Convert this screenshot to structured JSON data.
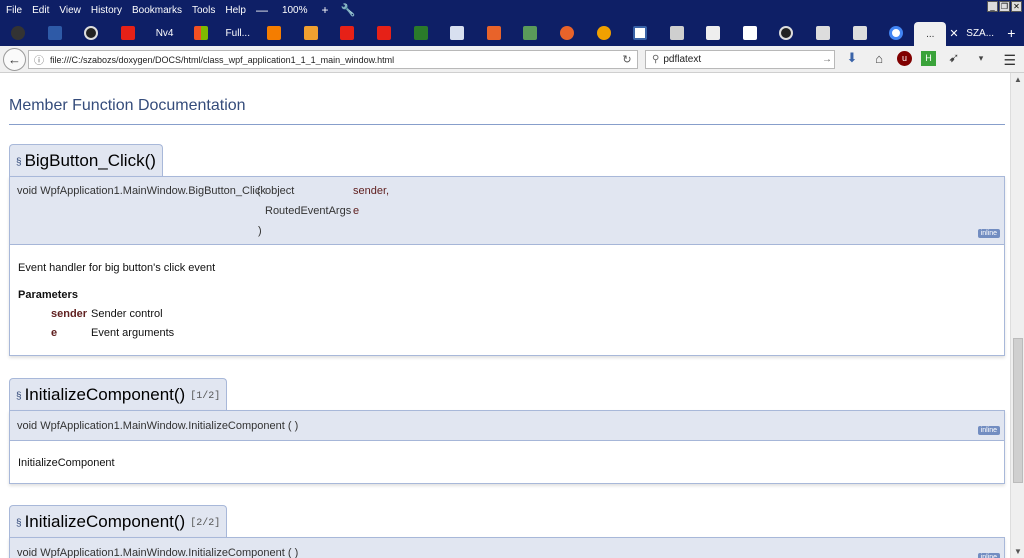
{
  "menubar": {
    "items": [
      "File",
      "Edit",
      "View",
      "History",
      "Bookmarks",
      "Tools",
      "Help"
    ],
    "zoom_out": "—",
    "zoom": "100%",
    "zoom_in": "+"
  },
  "tabs": {
    "text_tabs": [
      "Nv4",
      "Full...",
      "SZA..."
    ],
    "active_tab": "...",
    "close": "✕",
    "new_tab": "+"
  },
  "navbar": {
    "url": "file:///C:/szabozs/doxygen/DOCS/html/class_wpf_application1_1_1_main_window.html",
    "search_value": "pdflatext"
  },
  "content": {
    "section_title": "Member Function Documentation",
    "members": [
      {
        "perm_mark": "§",
        "title": "BigButton_Click()",
        "sig_prefix": "void WpfApplication1.MainWindow.BigButton_Click",
        "open_paren": "(",
        "param1_type": "object",
        "param1_name": "sender,",
        "param2_type": "RoutedEventArgs",
        "param2_name": "e",
        "close_paren": ")",
        "badge": "inline",
        "brief": "Event handler for big button's click event",
        "params_heading": "Parameters",
        "params": [
          {
            "name": "sender",
            "desc": "Sender control"
          },
          {
            "name": "e",
            "desc": "Event arguments"
          }
        ]
      },
      {
        "perm_mark": "§",
        "title": "InitializeComponent()",
        "overload": "[1/2]",
        "sig": "void WpfApplication1.MainWindow.InitializeComponent (  )",
        "badge": "inline",
        "brief": "InitializeComponent"
      },
      {
        "perm_mark": "§",
        "title": "InitializeComponent()",
        "overload": "[2/2]",
        "sig": "void WpfApplication1.MainWindow.InitializeComponent (  )",
        "badge": "inline"
      }
    ]
  }
}
